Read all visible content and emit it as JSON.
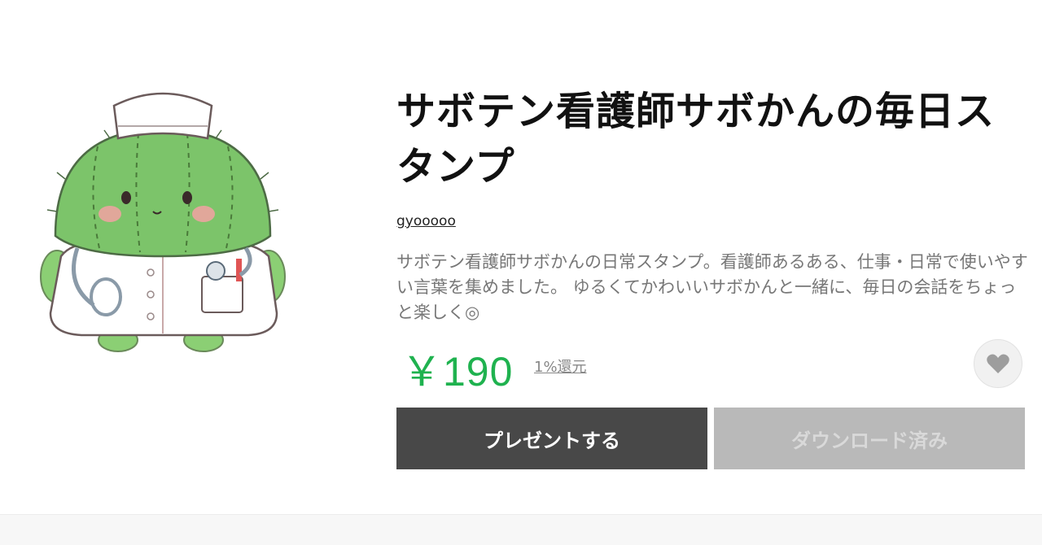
{
  "product": {
    "title": "サボテン看護師サボかんの毎日スタンプ",
    "author": "gyooooo",
    "description": "サボテン看護師サボかんの日常スタンプ。看護師あるある、仕事・日常で使いやすい言葉を集めました。 ゆるくてかわいいサボかんと一緒に、毎日の会話をちょっと楽しく◎",
    "price": "￥190",
    "reward": "1%還元"
  },
  "actions": {
    "present_label": "プレゼントする",
    "download_label": "ダウンロード済み"
  },
  "icons": {
    "favorite": "heart-icon",
    "main_image": "cactus-nurse-sticker"
  },
  "colors": {
    "price": "#1fb24f",
    "present_button": "#484848",
    "download_button": "#b9b9b9",
    "cactus": "#7cc46a"
  }
}
